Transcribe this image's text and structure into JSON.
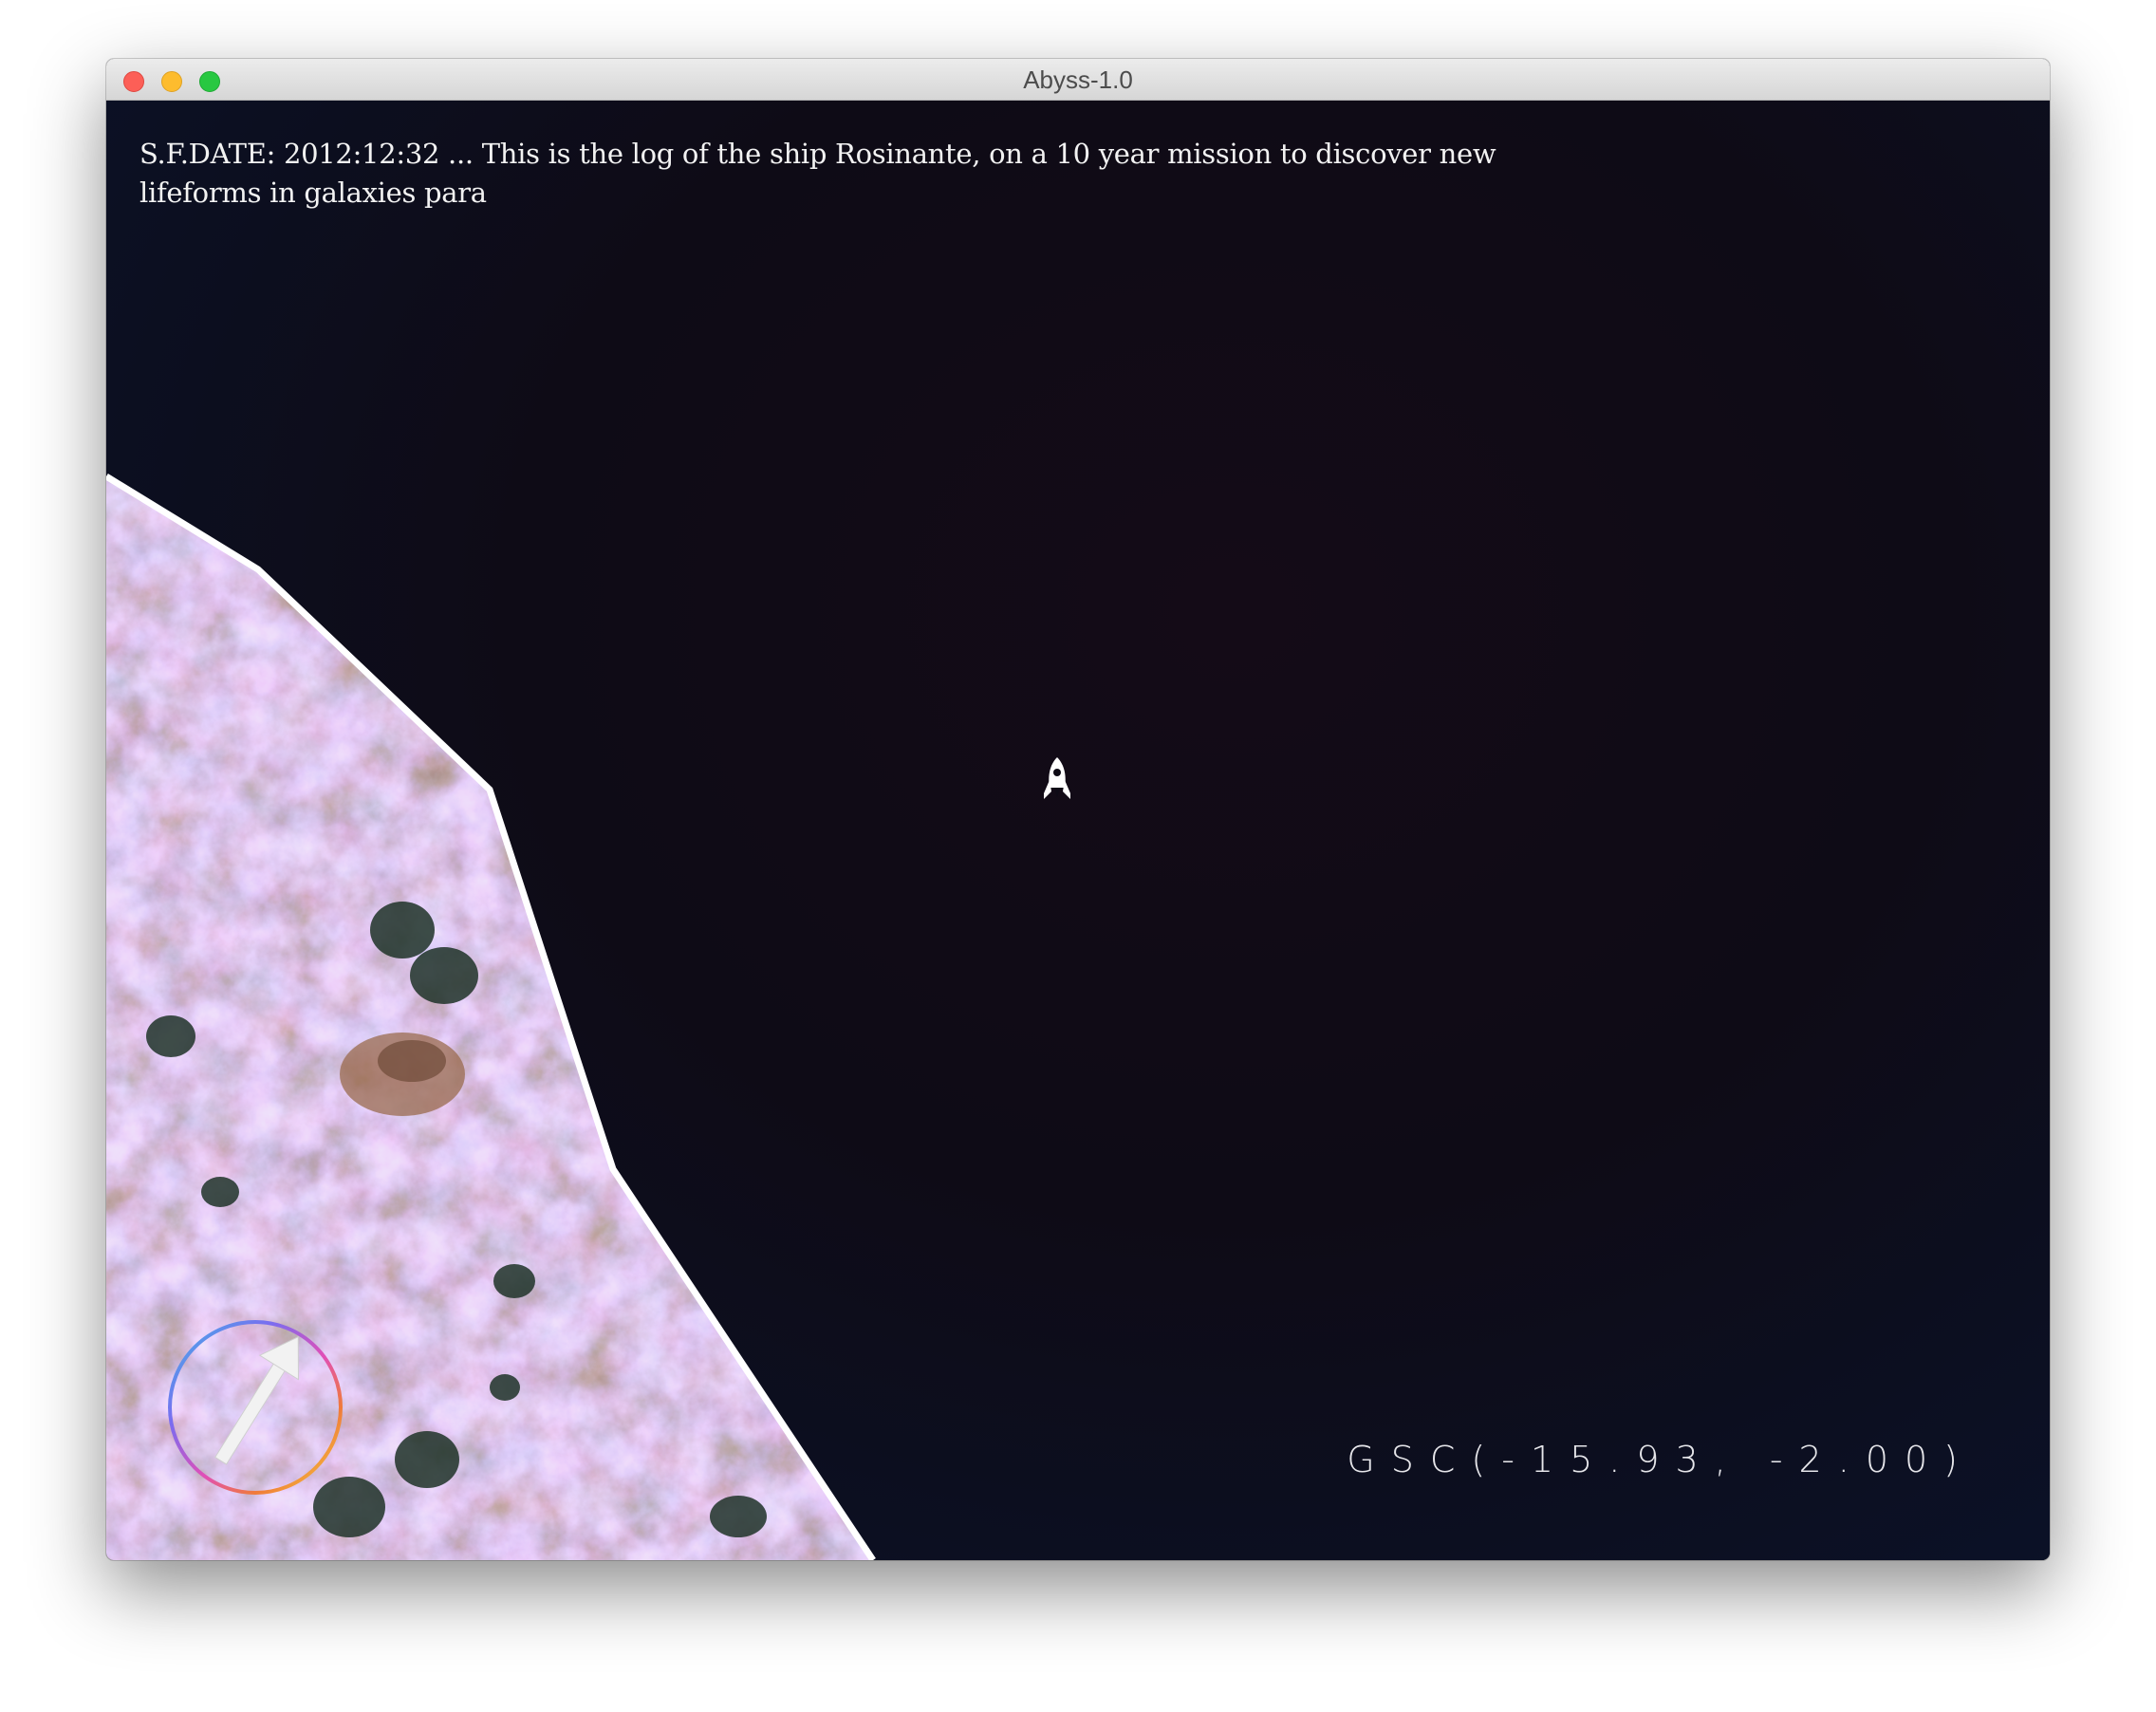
{
  "window": {
    "title": "Abyss-1.0"
  },
  "hud": {
    "log_text": "S.F.DATE: 2012:12:32 ... This is the log of the ship Rosinante, on a 10 year mission to discover new\nlifeforms in galaxies para",
    "coordinates": "GSC(-15.93, -2.00)"
  },
  "scene": {
    "ship_icon": "rocket-icon",
    "compass_icon": "compass-arrow-icon",
    "terrain": "rocky-planet-surface",
    "colors": {
      "space_dark": "#0e0b16",
      "space_blue": "#0a1428",
      "terrain_edge": "#ffffff",
      "hud_text": "#f2f2f2"
    }
  }
}
